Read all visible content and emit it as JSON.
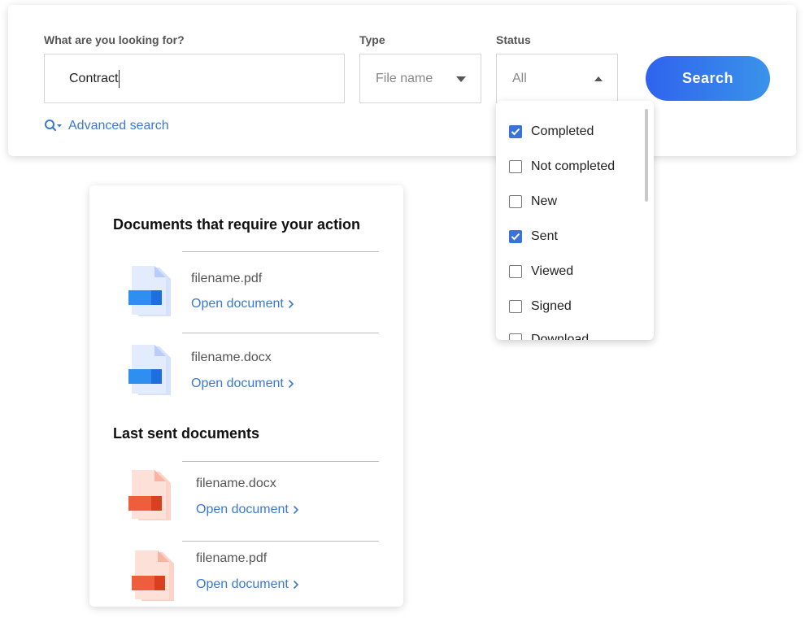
{
  "search": {
    "query_label": "What are you looking for?",
    "query_value": "Contract",
    "type_label": "Type",
    "type_value": "File name",
    "status_label": "Status",
    "status_value": "All",
    "button_label": "Search",
    "advanced_label": "Advanced search"
  },
  "status_options": [
    {
      "label": "Completed",
      "checked": true
    },
    {
      "label": "Not completed",
      "checked": false
    },
    {
      "label": "New",
      "checked": false
    },
    {
      "label": "Sent",
      "checked": true
    },
    {
      "label": "Viewed",
      "checked": false
    },
    {
      "label": "Signed",
      "checked": false
    },
    {
      "label": "Download",
      "checked": false
    }
  ],
  "action_docs": {
    "title": "Documents that require your action",
    "items": [
      {
        "name": "filename.pdf",
        "link": "Open document"
      },
      {
        "name": "filename.docx",
        "link": "Open document"
      }
    ]
  },
  "sent_docs": {
    "title": "Last sent documents",
    "items": [
      {
        "name": "filename.docx",
        "link": "Open document"
      },
      {
        "name": "filename.pdf",
        "link": "Open document"
      }
    ]
  },
  "colors": {
    "accent": "#3a78d4",
    "button_start": "#2f63ee",
    "button_end": "#3a93ea",
    "blue_icon": "#2f8ff0",
    "red_icon": "#ee5e3c"
  }
}
